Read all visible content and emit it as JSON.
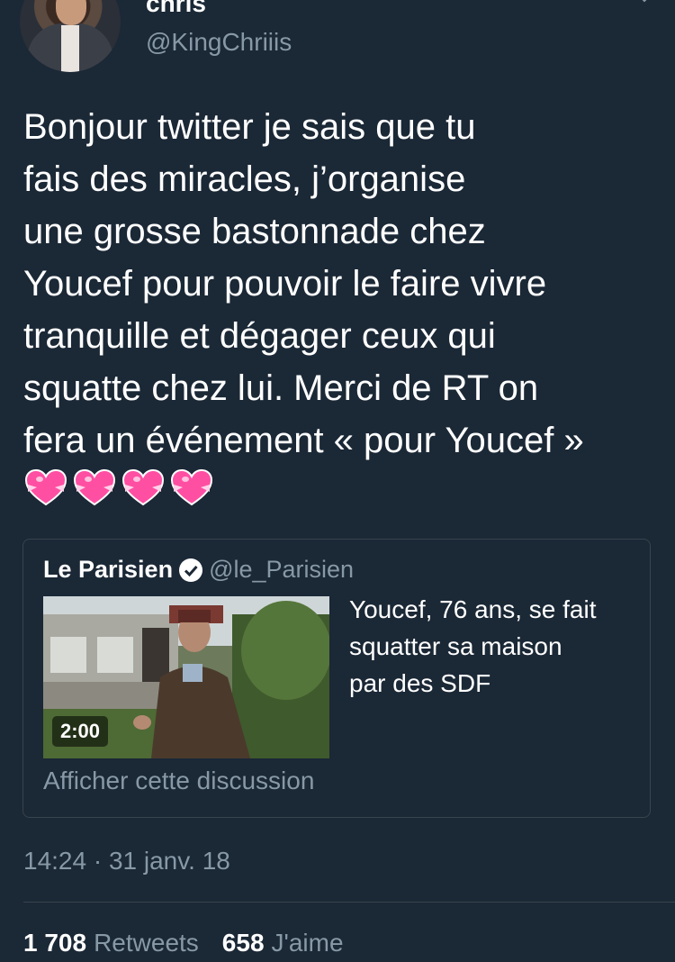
{
  "author": {
    "display_name": "chris",
    "handle": "@KingChriiis"
  },
  "tweet": {
    "text": "Bonjour twitter je sais que tu\nfais des miracles, j’organise\nune grosse bastonnade chez\nYoucef pour pouvoir le faire vivre\ntranquille et dégager ceux qui\nsquatte chez lui. Merci de RT on\nfera un événement « pour Youcef »",
    "emojis": [
      "heart-with-ribbon-icon",
      "heart-with-ribbon-icon",
      "heart-with-ribbon-icon",
      "heart-with-ribbon-icon"
    ]
  },
  "quote": {
    "name": "Le Parisien",
    "handle": "@le_Parisien",
    "verified": true,
    "text": "Youcef, 76 ans, se fait\nsquatter sa maison\npar des SDF",
    "video_duration": "2:00",
    "show_thread": "Afficher cette discussion"
  },
  "meta": {
    "timestamp": "14:24 · 31 janv. 18"
  },
  "stats": {
    "retweets_count": "1 708",
    "retweets_label": "Retweets",
    "likes_count": "658",
    "likes_label": "J'aime"
  },
  "colors": {
    "background": "#1b2836",
    "secondary_text": "#8899a6",
    "border": "#38444d",
    "verified_blue": "#ffffff",
    "heart_pink": "#ff4fa3"
  }
}
